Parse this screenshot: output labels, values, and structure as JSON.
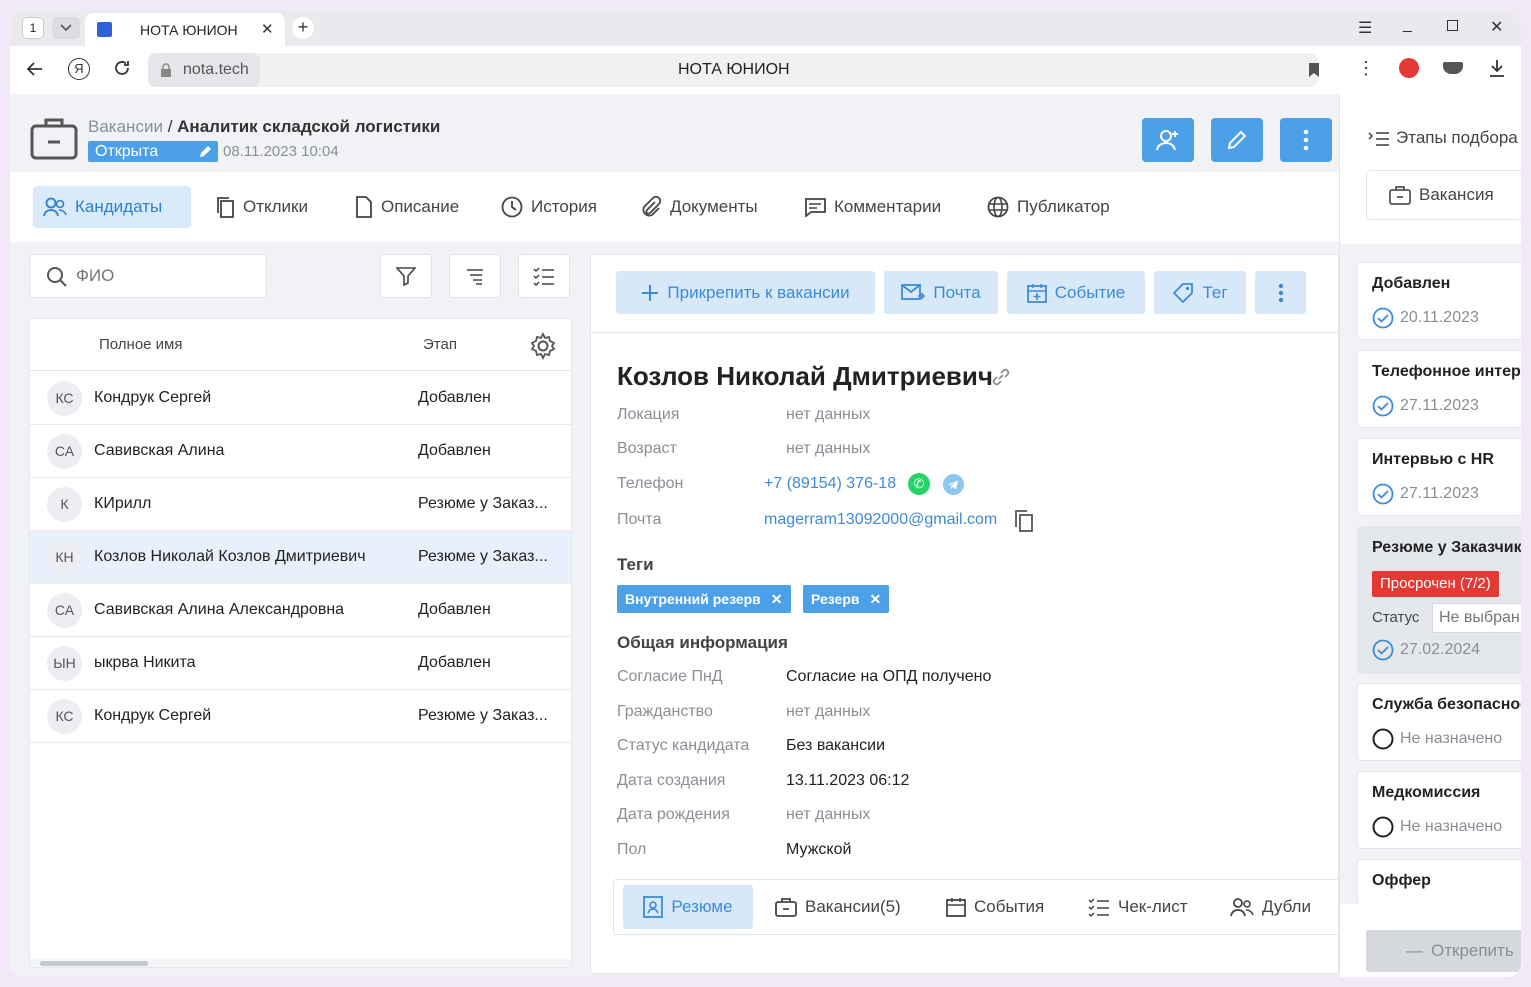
{
  "browser": {
    "tab_counter": "1",
    "tab_title": "НОТА ЮНИОН",
    "url": "nota.tech",
    "page_title": "НОТА ЮНИОН"
  },
  "header": {
    "breadcrumb_parent": "Вакансии",
    "breadcrumb_sep": "/",
    "title": "Аналитик складской логистики",
    "status": "Открыта",
    "datetime": "08.11.2023 10:04"
  },
  "tabs": [
    {
      "label": "Кандидаты",
      "icon": "users-icon"
    },
    {
      "label": "Отклики",
      "icon": "copy-icon"
    },
    {
      "label": "Описание",
      "icon": "file-icon"
    },
    {
      "label": "История",
      "icon": "clock-icon"
    },
    {
      "label": "Документы",
      "icon": "paperclip-icon"
    },
    {
      "label": "Комментарии",
      "icon": "comment-icon"
    },
    {
      "label": "Публикатор",
      "icon": "globe-icon"
    }
  ],
  "search": {
    "placeholder": "ФИО"
  },
  "table": {
    "col_name": "Полное имя",
    "col_stage": "Этап",
    "rows": [
      {
        "initials": "КС",
        "name": "Кондрук Сергей",
        "stage": "Добавлен"
      },
      {
        "initials": "СА",
        "name": "Савивская Алина",
        "stage": "Добавлен"
      },
      {
        "initials": "К",
        "name": "КИрилл",
        "stage": "Резюме у Заказ..."
      },
      {
        "initials": "КН",
        "name": "Козлов Николай Козлов Дмитриевич",
        "stage": "Резюме у Заказ..."
      },
      {
        "initials": "СА",
        "name": "Савивская Алина Александровна",
        "stage": "Добавлен"
      },
      {
        "initials": "ЫН",
        "name": "ыкрва Никита",
        "stage": "Добавлен"
      },
      {
        "initials": "КС",
        "name": "Кондрук Сергей",
        "stage": "Резюме у Заказ..."
      }
    ]
  },
  "actions": {
    "attach": "Прикрепить к вакансии",
    "mail": "Почта",
    "event": "Событие",
    "tag": "Тег"
  },
  "candidate": {
    "name": "Козлов Николай Дмитриевич",
    "fields": {
      "location_label": "Локация",
      "location_value": "нет данных",
      "age_label": "Возраст",
      "age_value": "нет данных",
      "phone_label": "Телефон",
      "phone_value": "+7 (89154) 376-18",
      "email_label": "Почта",
      "email_value": "magerram13092000@gmail.com"
    },
    "tags_title": "Теги",
    "tags": [
      "Внутренний резерв",
      "Резерв"
    ],
    "general_title": "Общая информация",
    "general": [
      {
        "label": "Согласие ПнД",
        "value": "Согласие на ОПД получено"
      },
      {
        "label": "Гражданство",
        "value": "нет данных"
      },
      {
        "label": "Статус кандидата",
        "value": "Без вакансии"
      },
      {
        "label": "Дата создания",
        "value": "13.11.2023 06:12"
      },
      {
        "label": "Дата рождения",
        "value": "нет данных"
      },
      {
        "label": "Пол",
        "value": "Мужской"
      }
    ]
  },
  "bottom_tabs": [
    {
      "label": "Резюме"
    },
    {
      "label": "Вакансии(5)"
    },
    {
      "label": "События"
    },
    {
      "label": "Чек-лист"
    },
    {
      "label": "Дубли"
    }
  ],
  "stages_panel": {
    "title": "Этапы подбора",
    "tab_vacancy": "Вакансия",
    "stages": [
      {
        "title": "Добавлен",
        "date": "20.11.2023",
        "state": "done"
      },
      {
        "title": "Телефонное интерв",
        "date": "27.11.2023",
        "state": "done"
      },
      {
        "title": "Интервью с HR",
        "date": "27.11.2023",
        "state": "done"
      },
      {
        "title": "Резюме у Заказчика",
        "overdue": "Просрочен (7/2)",
        "status_label": "Статус",
        "status_placeholder": "Не выбран",
        "date": "27.02.2024",
        "state": "done"
      },
      {
        "title": "Служба безопаснос",
        "date": "Не назначено",
        "state": "pending"
      },
      {
        "title": "Медкомиссия",
        "date": "Не назначено",
        "state": "pending"
      },
      {
        "title": "Оффер"
      }
    ],
    "detach": "Открепить"
  },
  "colors": {
    "accent": "#4ba0e8",
    "overdue": "#e53935",
    "whatsapp": "#25d366",
    "telegram": "#54a9eb"
  }
}
